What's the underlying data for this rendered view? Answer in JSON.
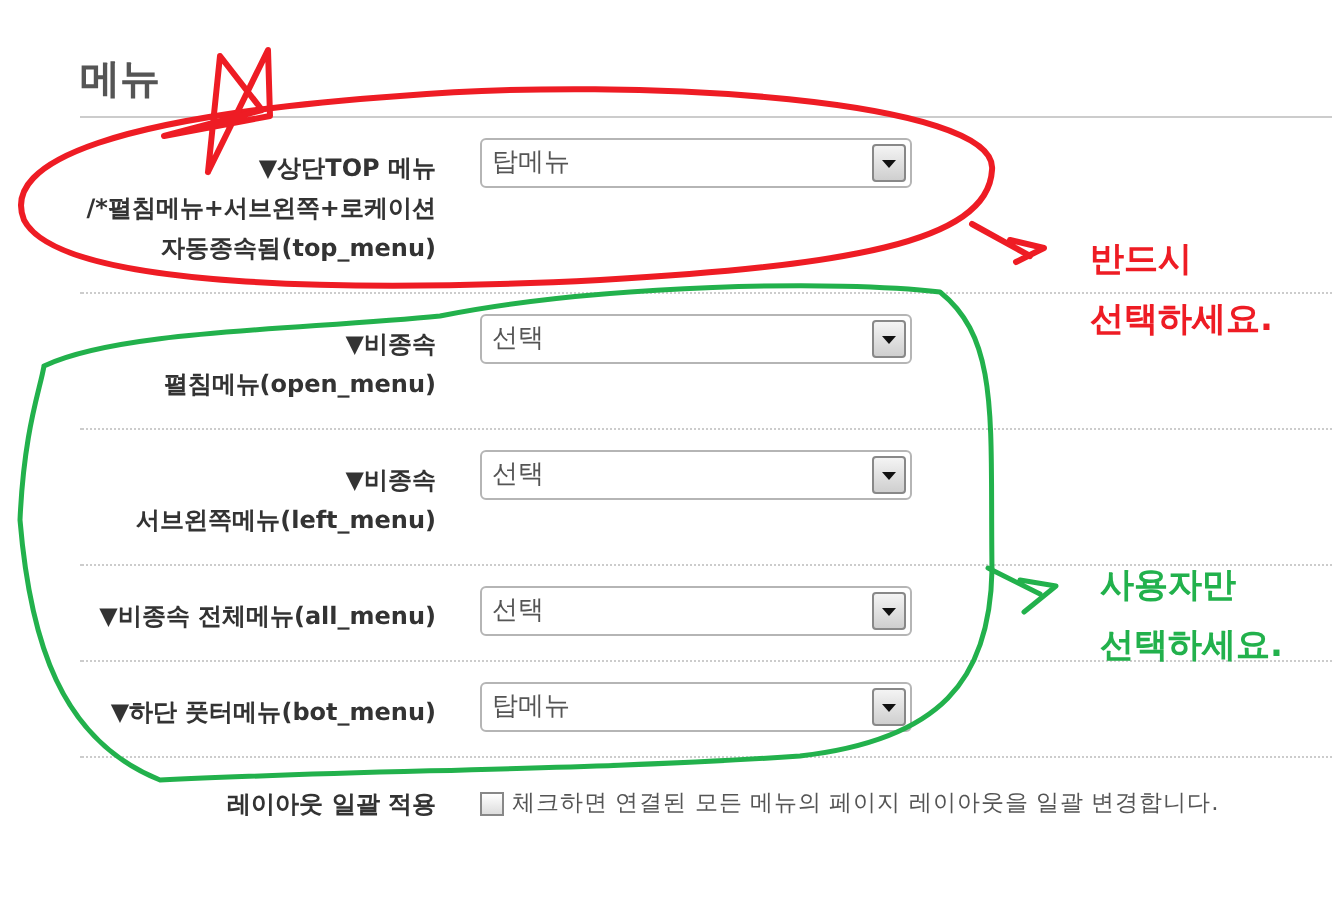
{
  "section": {
    "title": "메뉴"
  },
  "rows": [
    {
      "label_lines": [
        "▼상단TOP 메뉴",
        "/*펼침메뉴+서브왼쪽+로케이션",
        "자동종속됨(top_menu)"
      ],
      "value": "탑메뉴"
    },
    {
      "label_lines": [
        "▼비종속",
        "펼침메뉴(open_menu)"
      ],
      "value": "선택"
    },
    {
      "label_lines": [
        "▼비종속",
        "서브왼쪽메뉴(left_menu)"
      ],
      "value": "선택"
    },
    {
      "label_lines": [
        "▼비종속 전체메뉴(all_menu)"
      ],
      "value": "선택"
    },
    {
      "label_lines": [
        "▼하단 풋터메뉴(bot_menu)"
      ],
      "value": "탑메뉴"
    }
  ],
  "option": {
    "label": "레이아웃 일괄 적용",
    "checked": false,
    "text": "체크하면 연결된 모든 메뉴의 페이지 레이아웃을 일괄 변경합니다."
  },
  "annotations": [
    {
      "lines": [
        "반드시",
        "선택하세요."
      ],
      "color": "#ee1c24"
    },
    {
      "lines": [
        "사용자만",
        "선택하세요."
      ],
      "color": "#22b14c"
    }
  ]
}
